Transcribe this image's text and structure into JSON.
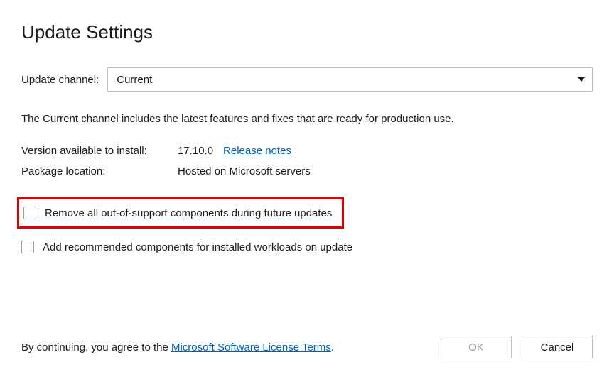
{
  "title": "Update Settings",
  "channel": {
    "label": "Update channel:",
    "selected": "Current"
  },
  "description": "The Current channel includes the latest features and fixes that are ready for production use.",
  "info": {
    "version_label": "Version available to install:",
    "version_value": "17.10.0",
    "release_notes": "Release notes",
    "package_label": "Package location:",
    "package_value": "Hosted on Microsoft servers"
  },
  "options": {
    "remove_oos": "Remove all out-of-support components during future updates",
    "add_recommended": "Add recommended components for installed workloads on update"
  },
  "legal": {
    "prefix": "By continuing, you agree to the ",
    "link": "Microsoft Software License Terms",
    "suffix": "."
  },
  "buttons": {
    "ok": "OK",
    "cancel": "Cancel"
  }
}
